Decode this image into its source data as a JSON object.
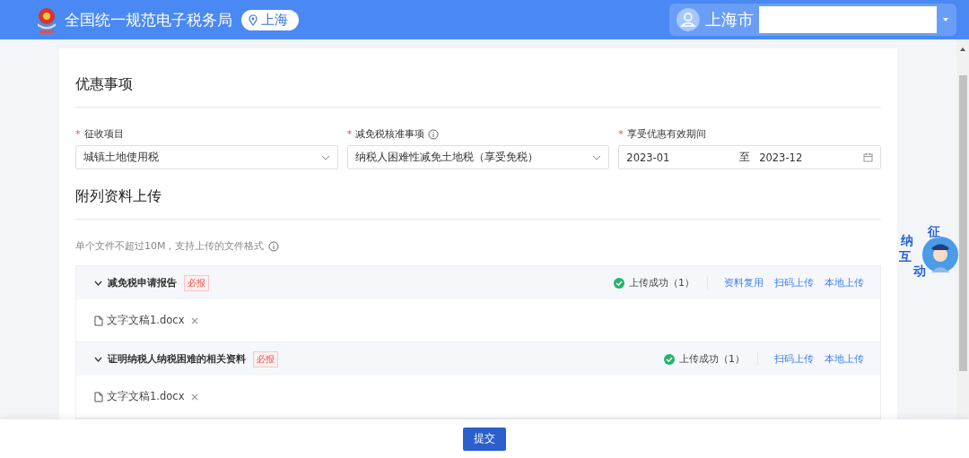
{
  "header": {
    "title": "全国统一规范电子税务局",
    "region": "上海",
    "user": "上海市"
  },
  "preferential": {
    "title": "优惠事项",
    "fields": [
      {
        "label": "征收项目",
        "required_mark": "*",
        "info": false,
        "kind": "select",
        "value": "城镇土地使用税"
      },
      {
        "label": "减免税核准事项",
        "required_mark": "*",
        "info": true,
        "kind": "select",
        "value": "纳税人困难性减免土地税（享受免税）"
      },
      {
        "label": "享受优惠有效期间",
        "required_mark": "*",
        "info": false,
        "kind": "range",
        "start": "2023-01",
        "separator": "至",
        "end": "2023-12"
      }
    ]
  },
  "attachments": {
    "title": "附列资料上传",
    "hint": "单个文件不超过10M，支持上传的文件格式",
    "groups": [
      {
        "name": "减免税申请报告",
        "tag": "必报",
        "expanded": true,
        "status": "上传成功（1）",
        "actions": [
          "资料复用",
          "扫码上传",
          "本地上传"
        ],
        "files": [
          "文字文稿1.docx"
        ]
      },
      {
        "name": "证明纳税人纳税困难的相关资料",
        "tag": "必报",
        "expanded": true,
        "status": "上传成功（1）",
        "actions": [
          "扫码上传",
          "本地上传"
        ],
        "files": [
          "文字文稿1.docx"
        ]
      }
    ]
  },
  "assistant": {
    "chars": [
      "征",
      "纳",
      "互",
      "动"
    ]
  },
  "footer": {
    "submit": "提交"
  }
}
